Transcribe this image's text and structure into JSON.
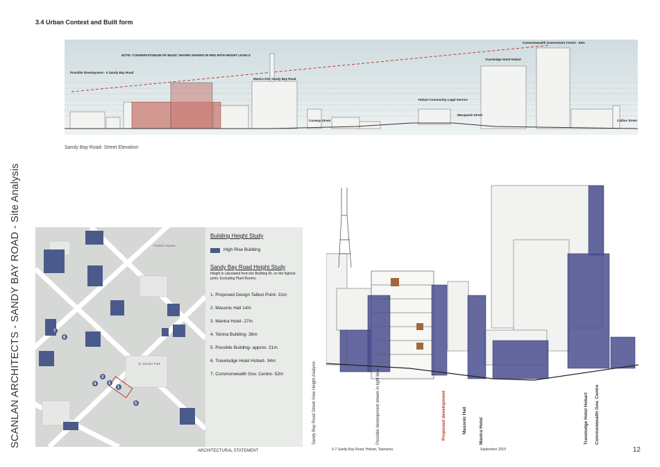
{
  "heading": "3.4 Urban Context and Built form",
  "elevation": {
    "caption": "Sandy Bay Road- Street Elevation",
    "note": "NOTE: CONSERVATORIUM OF MUSIC SHOWN SHADED IN RED WITH HEIGHT LEVELS",
    "labels": {
      "possible": "Possible Development - 5 Sandy Bay Road",
      "mantra": "Mantra One Sandy Bay Road",
      "legal": "Hobart Community Legal Service",
      "conway": "Conway Street",
      "macquarie": "Macquarie Street",
      "travelodge": "Travelodge Hotel Hobart",
      "commonwealth": "Commonwealth Government Centre - 52m",
      "collins": "Collins Street"
    }
  },
  "side_title": "SCANLAN ARCHITECTS - SANDY BAY ROAD - Site Analysis",
  "legend": {
    "study_title": "Building Height Study",
    "high_rise_label": "High Rise Building",
    "road_title": "Sandy Bay Road Height Study",
    "road_note": "Height is calculated from the Building RL on the highest point. Excluding Plant Rooms.",
    "items": [
      "1. Proposed Design Tallest Point- 31m",
      "2. Masonic Hall 14m",
      "3. Mantra Hotel- 27m",
      "4. Telstra Building- 36m",
      "5. Possible Building- approx. 21m",
      "6. Travelodge Hotel Hobart- 34m",
      "7. Commonwealth Gov. Centre- 52m"
    ]
  },
  "map_markers": [
    "1",
    "2",
    "3",
    "4",
    "5",
    "6",
    "7"
  ],
  "map_labels": {
    "park": "St. David's Park",
    "franklin": "Franklin Square"
  },
  "street_view": {
    "vertical_caption": "Sandy Bay Road Street View Height Analysis",
    "labels": [
      "Possible development shown in light blue",
      "Proposed development",
      "Masonic Hall",
      "Mantra Hotel",
      "Travelodge Hotel Hobart",
      "Commonwealth Gov. Centre"
    ]
  },
  "footer": {
    "statement": "ARCHITECTURAL STATEMENT",
    "address": "5-7 Sandy Bay Road, Hobart, Tasmania",
    "date": "September 2019",
    "page": "12"
  },
  "colors": {
    "high_rise": "#4a5a8a",
    "proposed": "#c97a72",
    "legend_bg": "#e8ebe8",
    "map_bg": "#d6d8d6"
  }
}
